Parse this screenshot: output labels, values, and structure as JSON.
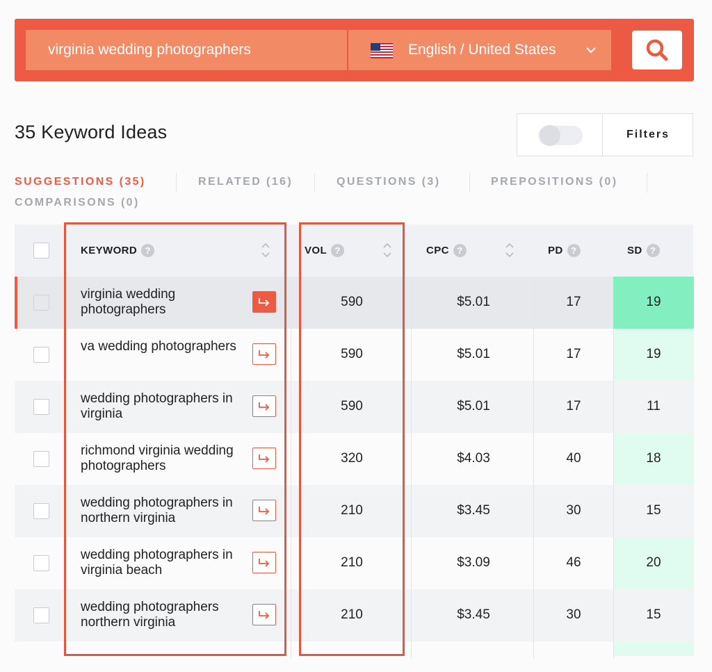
{
  "search": {
    "keyword": "virginia wedding photographers",
    "language": "English / United States"
  },
  "heading": {
    "ideas_title": "35 Keyword Ideas"
  },
  "filters": {
    "label": "Filters",
    "toggle_on": false
  },
  "tabs": [
    {
      "label": "SUGGESTIONS (35)",
      "active": true
    },
    {
      "label": "RELATED (16)",
      "active": false
    },
    {
      "label": "QUESTIONS (3)",
      "active": false
    },
    {
      "label": "PREPOSITIONS (0)",
      "active": false
    },
    {
      "label": "COMPARISONS (0)",
      "active": false
    }
  ],
  "table": {
    "columns": {
      "keyword": "KEYWORD",
      "vol": "VOL",
      "cpc": "CPC",
      "pd": "PD",
      "sd": "SD"
    },
    "help_glyph": "?",
    "rows": [
      {
        "keyword": "virginia wedding photographers",
        "vol": "590",
        "cpc": "$5.01",
        "pd": "17",
        "sd": "19"
      },
      {
        "keyword": "va wedding photographers",
        "vol": "590",
        "cpc": "$5.01",
        "pd": "17",
        "sd": "19"
      },
      {
        "keyword": "wedding photographers in virginia",
        "vol": "590",
        "cpc": "$5.01",
        "pd": "17",
        "sd": "11"
      },
      {
        "keyword": "richmond virginia wedding photographers",
        "vol": "320",
        "cpc": "$4.03",
        "pd": "40",
        "sd": "18"
      },
      {
        "keyword": "wedding photographers in northern virginia",
        "vol": "210",
        "cpc": "$3.45",
        "pd": "30",
        "sd": "15"
      },
      {
        "keyword": "wedding photographers in virginia beach",
        "vol": "210",
        "cpc": "$3.09",
        "pd": "46",
        "sd": "20"
      },
      {
        "keyword": "wedding photographers northern virginia",
        "vol": "210",
        "cpc": "$3.45",
        "pd": "30",
        "sd": "15"
      }
    ]
  },
  "colors": {
    "brand": "#ec5a43",
    "accent": "#ef5a42",
    "sd_low": "#83eec0",
    "sd_bg": "#e0fbef",
    "highlight_box": "#e8553f"
  },
  "icons": [
    "us-flag-icon",
    "chevron-down-icon",
    "search-icon",
    "help-icon",
    "sort-icon",
    "open-arrow-icon",
    "checkbox"
  ]
}
